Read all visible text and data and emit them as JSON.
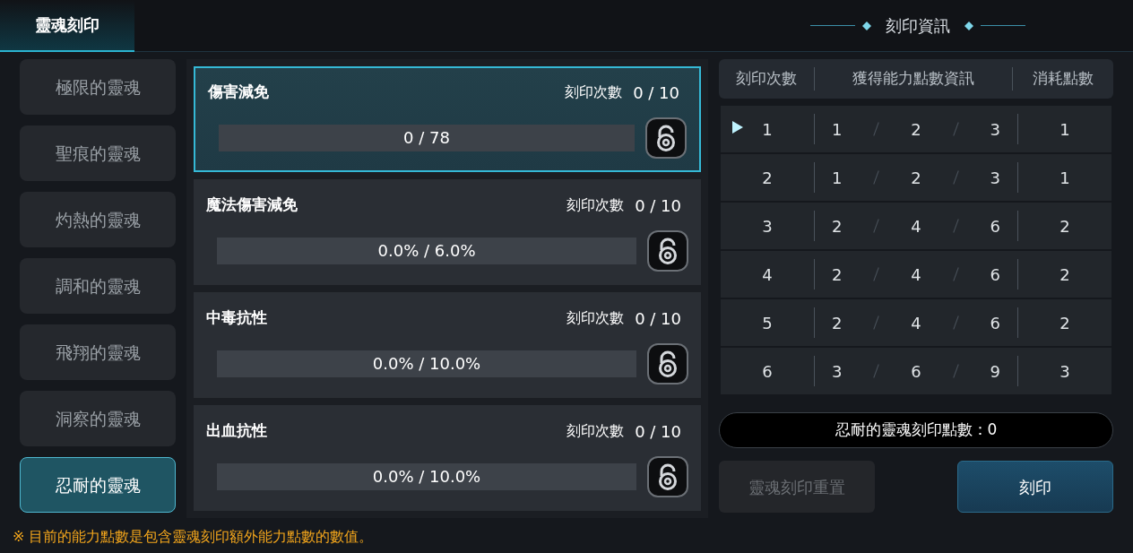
{
  "header": {
    "title": "靈魂刻印",
    "info_title": "刻印資訊"
  },
  "souls": [
    {
      "label": "極限的靈魂",
      "selected": false
    },
    {
      "label": "聖痕的靈魂",
      "selected": false
    },
    {
      "label": "灼熱的靈魂",
      "selected": false
    },
    {
      "label": "調和的靈魂",
      "selected": false
    },
    {
      "label": "飛翔的靈魂",
      "selected": false
    },
    {
      "label": "洞察的靈魂",
      "selected": false
    },
    {
      "label": "忍耐的靈魂",
      "selected": true
    }
  ],
  "stats": [
    {
      "name": "傷害減免",
      "count_label": "刻印次數",
      "count": "0 / 10",
      "bar": "0 / 78",
      "level": 0,
      "selected": true
    },
    {
      "name": "魔法傷害減免",
      "count_label": "刻印次數",
      "count": "0 / 10",
      "bar": "0.0% / 6.0%",
      "level": 0,
      "selected": false
    },
    {
      "name": "中毒抗性",
      "count_label": "刻印次數",
      "count": "0 / 10",
      "bar": "0.0% / 10.0%",
      "level": 0,
      "selected": false
    },
    {
      "name": "出血抗性",
      "count_label": "刻印次數",
      "count": "0 / 10",
      "bar": "0.0% / 10.0%",
      "level": 0,
      "selected": false
    }
  ],
  "table": {
    "columns": [
      "刻印次數",
      "獲得能力點數資訊",
      "消耗點數"
    ],
    "rows": [
      {
        "count": "1",
        "values": [
          "1",
          "2",
          "3"
        ],
        "cost": "1",
        "selected": true
      },
      {
        "count": "2",
        "values": [
          "1",
          "2",
          "3"
        ],
        "cost": "1",
        "selected": false
      },
      {
        "count": "3",
        "values": [
          "2",
          "4",
          "6"
        ],
        "cost": "2",
        "selected": false
      },
      {
        "count": "4",
        "values": [
          "2",
          "4",
          "6"
        ],
        "cost": "2",
        "selected": false
      },
      {
        "count": "5",
        "values": [
          "2",
          "4",
          "6"
        ],
        "cost": "2",
        "selected": false
      },
      {
        "count": "6",
        "values": [
          "3",
          "6",
          "9"
        ],
        "cost": "3",
        "selected": false
      }
    ]
  },
  "points": "忍耐的靈魂刻印點數：0",
  "buttons": [
    {
      "label": "靈魂刻印重置",
      "disabled": true
    },
    {
      "label": "刻印",
      "disabled": false
    }
  ],
  "note": "※ 目前的能力點數是包含靈魂刻印額外能力點數的數值。"
}
